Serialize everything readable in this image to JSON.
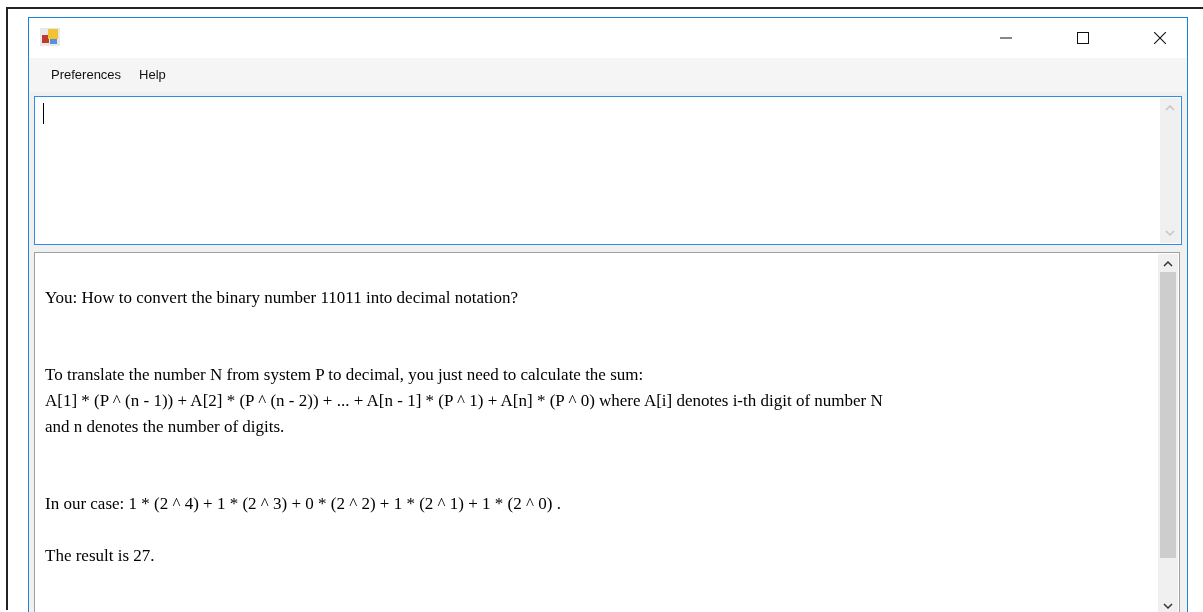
{
  "window": {
    "title_icon": true
  },
  "menu": [
    {
      "label": "Preferences"
    },
    {
      "label": "Help"
    }
  ],
  "input": {
    "focused": true
  },
  "output": {
    "paragraphs": [
      {
        "lines": [
          "You: How to convert the binary number 11011 into decimal notation?"
        ]
      },
      {
        "lines": [
          "To translate the number N from system P to decimal, you just need to calculate the sum:",
          "A[1] * (P ^ (n - 1)) + A[2] * (P ^ (n - 2)) + ... + A[n - 1] * (P ^ 1) + A[n] * (P ^ 0) where A[i] denotes i-th digit of number N",
          "and n denotes the number of digits."
        ]
      },
      {
        "lines": [
          "In our case: 1 * (2 ^ 4) + 1 * (2 ^ 3) + 0 * (2 ^ 2) + 1 * (2 ^ 1) + 1 * (2 ^ 0) ."
        ]
      },
      {
        "lines": [
          "The result is 27."
        ]
      }
    ]
  }
}
